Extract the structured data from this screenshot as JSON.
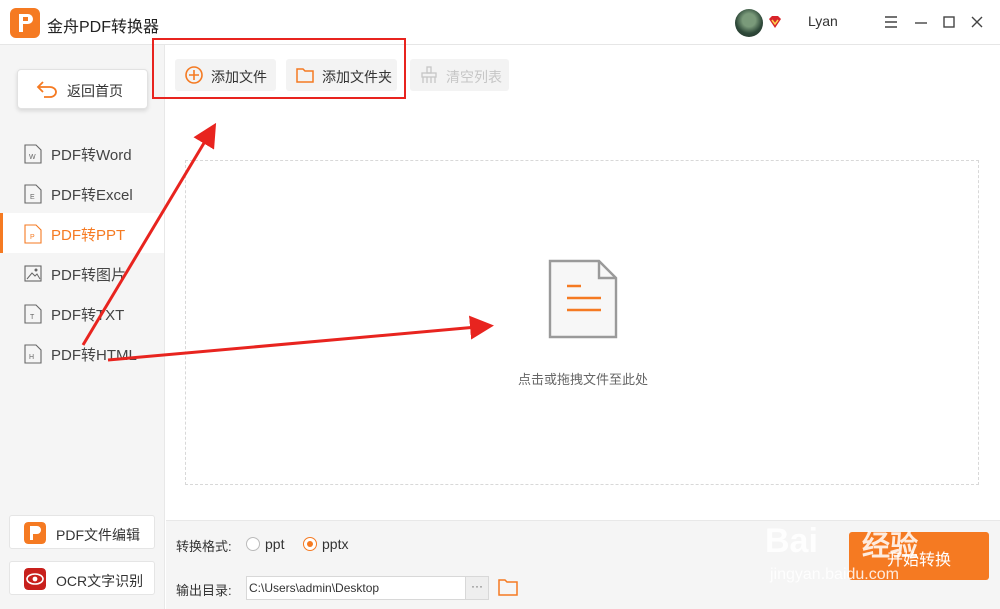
{
  "app": {
    "title": "金舟PDF转换器",
    "username": "Lyan",
    "accent_color": "#f57a22"
  },
  "sidebar": {
    "home_label": "返回首页",
    "items": [
      {
        "label": "PDF转Word",
        "icon": "word-doc-icon"
      },
      {
        "label": "PDF转Excel",
        "icon": "excel-doc-icon"
      },
      {
        "label": "PDF转PPT",
        "icon": "ppt-doc-icon",
        "active": true
      },
      {
        "label": "PDF转图片",
        "icon": "image-doc-icon"
      },
      {
        "label": "PDF转TXT",
        "icon": "txt-doc-icon"
      },
      {
        "label": "PDF转HTML",
        "icon": "html-doc-icon"
      }
    ],
    "tools": [
      {
        "label": "PDF文件编辑",
        "icon": "pdf-edit-icon"
      },
      {
        "label": "OCR文字识别",
        "icon": "ocr-eye-icon"
      }
    ]
  },
  "toolbar": {
    "add_file_label": "添加文件",
    "add_folder_label": "添加文件夹",
    "clear_list_label": "清空列表"
  },
  "dropzone": {
    "hint": "点击或拖拽文件至此处"
  },
  "bottom": {
    "format_label": "转换格式:",
    "format_options": [
      "ppt",
      "pptx"
    ],
    "format_selected": "pptx",
    "output_label": "输出目录:",
    "output_path": "C:\\Users\\admin\\Desktop",
    "browse_label": "···",
    "start_label": "开始转换"
  },
  "watermark": {
    "line1": "Bai",
    "line2": "经验",
    "line3": "jingyan.baidu.com"
  }
}
